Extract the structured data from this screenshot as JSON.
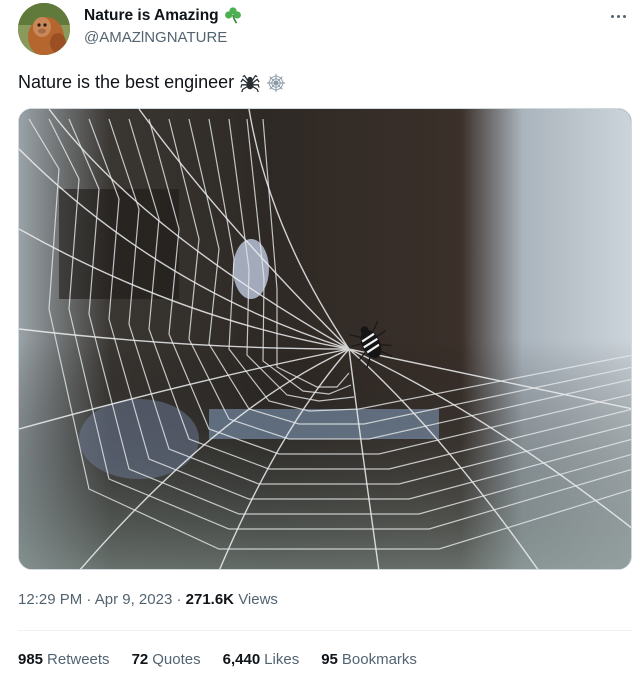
{
  "author": {
    "display_name": "Nature is Amazing",
    "handle": "@AMAZlNGNATURE",
    "name_emoji": "shamrock-icon"
  },
  "tweet": {
    "text": "Nature is the best engineer",
    "emojis": [
      "spider-icon",
      "spider-web-icon"
    ]
  },
  "media": {
    "description_icon": "spider-web-video"
  },
  "meta": {
    "time": "12:29 PM",
    "separator": "·",
    "date": "Apr 9, 2023",
    "views_count": "271.6K",
    "views_label": "Views"
  },
  "stats": {
    "retweets": {
      "count": "985",
      "label": "Retweets"
    },
    "quotes": {
      "count": "72",
      "label": "Quotes"
    },
    "likes": {
      "count": "6,440",
      "label": "Likes"
    },
    "bookmarks": {
      "count": "95",
      "label": "Bookmarks"
    }
  },
  "colors": {
    "text_primary": "#0f1419",
    "text_secondary": "#536471",
    "divider": "#eff3f4",
    "shamrock": "#4caf50"
  }
}
